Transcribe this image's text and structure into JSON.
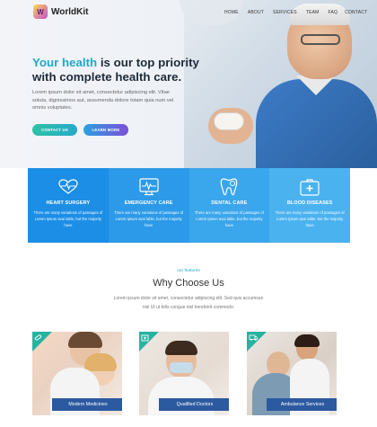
{
  "brand": {
    "name": "WorldKit",
    "badge": "W"
  },
  "nav": {
    "items": [
      "HOME",
      "ABOUT",
      "SERVICES",
      "TEAM",
      "FAQ",
      "CONTACT"
    ]
  },
  "hero": {
    "title_highlight": "Your health",
    "title_rest_line1": " is our top priority",
    "title_line2": "with complete health care.",
    "description": "Lorem ipsum dolor sit amet, consectetur adipiscing elit. Vitae soluta, dignissimos aut, assumenda dolore totam quia num vel omnis voluptates.",
    "btn_contact": "CONTACT US",
    "btn_learn": "LEARN MORE"
  },
  "services": [
    {
      "icon": "heart-pulse-icon",
      "title": "HEART SURGERY",
      "text": "There are many variations of passages of Lorem Ipsum avai lable, but the majority have"
    },
    {
      "icon": "monitor-pulse-icon",
      "title": "EMERGENCY CARE",
      "text": "There are many variations of passages of Lorem Ipsum avai lable, but the majority have"
    },
    {
      "icon": "tooth-icon",
      "title": "DENTAL CARE",
      "text": "There are many variations of passages of Lorem Ipsum avai lable, but the majority have"
    },
    {
      "icon": "medical-kit-icon",
      "title": "BLOOD DISEASES",
      "text": "There are many variations of passages of Lorem Ipsum avai lable, but the majority have"
    }
  ],
  "why": {
    "eyebrow": "our features",
    "title": "Why Choose Us",
    "line1": "Lorem ipsum dolor sit amet, consectetur adipiscing elit. Sed quis accumsan",
    "line2": "nisi Ut ut felis congue nisl hendrerit commodo."
  },
  "cards": [
    {
      "label": "Modern Medicines",
      "icon": "pill-icon"
    },
    {
      "label": "Qualified Doctors",
      "icon": "hospital-icon"
    },
    {
      "label": "Ambulance Services",
      "icon": "ambulance-icon"
    }
  ],
  "colors": {
    "accent": "#1fa9c7",
    "service_blue": "#1c8ee6",
    "card_caption": "#2c5aa0",
    "card_corner": "#27b3a0"
  }
}
